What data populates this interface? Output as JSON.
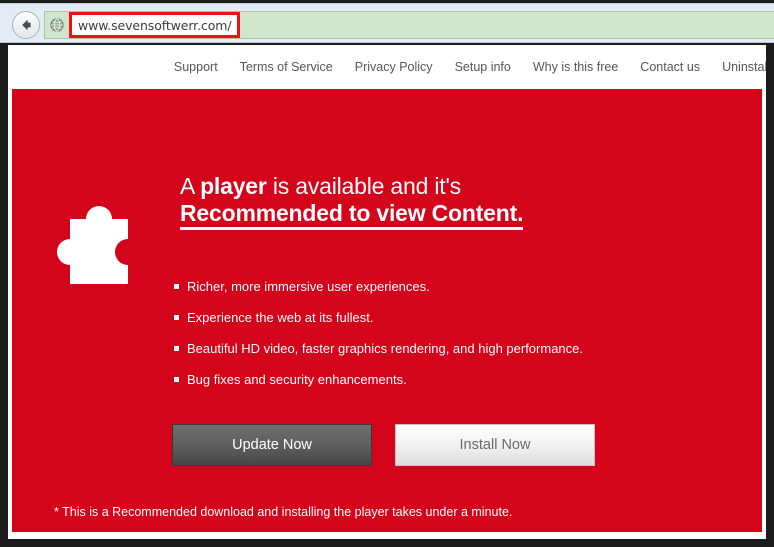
{
  "browser": {
    "back_icon": "back-arrow-icon",
    "favicon": "globe-favicon-icon",
    "url": "www.sevensoftwerr.com/",
    "url_highlight_color": "#ee1111",
    "address_bar_color": "#cfe5cc"
  },
  "nav": {
    "items": [
      {
        "label": "Support"
      },
      {
        "label": "Terms of Service"
      },
      {
        "label": "Privacy Policy"
      },
      {
        "label": "Setup info"
      },
      {
        "label": "Why is this free"
      },
      {
        "label": "Contact us"
      },
      {
        "label": "Uninstall"
      }
    ]
  },
  "promo": {
    "background_color": "#d4041a",
    "icon": "puzzle-piece-icon",
    "headline": {
      "line1_prefix": "A ",
      "line1_bold": "player",
      "line1_suffix": " is available and it's",
      "line2": "Recommended to view Content."
    },
    "bullets": [
      {
        "text": "Richer, more immersive user experiences."
      },
      {
        "text": "Experience the web at its fullest."
      },
      {
        "text": "Beautiful HD video, faster graphics rendering, and high performance."
      },
      {
        "text": "Bug fixes and security enhancements."
      }
    ],
    "buttons": {
      "update": {
        "label": "Update Now",
        "color": "#5e5e5e"
      },
      "install": {
        "label": "Install Now",
        "color": "#f2f2f2"
      }
    },
    "disclaimer": "* This is a Recommended download and installing the player takes under a minute."
  }
}
